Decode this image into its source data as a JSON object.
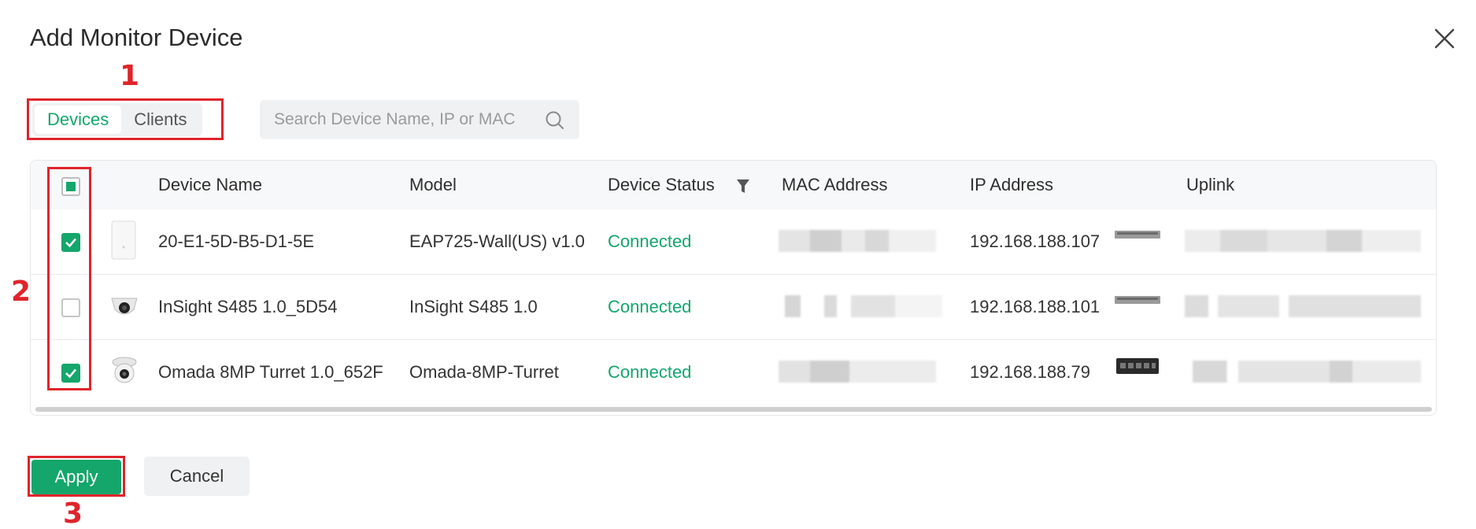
{
  "dialog": {
    "title": "Add Monitor Device",
    "close_icon": "close-icon"
  },
  "annotations": {
    "step1": "1",
    "step2": "2",
    "step3": "3",
    "color": "#e0242b"
  },
  "tabs": [
    {
      "label": "Devices",
      "active": true
    },
    {
      "label": "Clients",
      "active": false
    }
  ],
  "search": {
    "placeholder": "Search Device Name, IP or MAC",
    "value": "",
    "icon": "search-icon"
  },
  "table": {
    "columns": [
      "Device Name",
      "Model",
      "Device Status",
      "MAC Address",
      "IP Address",
      "Uplink"
    ],
    "status_filter_icon": "filter-icon",
    "select_all": "indeterminate",
    "rows": [
      {
        "checked": true,
        "thumbnail": "ap-wall-icon",
        "device_name": "20-E1-5D-B5-D1-5E",
        "model": "EAP725-Wall(US) v1.0",
        "status": "Connected",
        "mac_address": "redacted",
        "ip_address": "192.168.188.107",
        "uplink_icon": "switch-icon",
        "uplink": "redacted"
      },
      {
        "checked": false,
        "thumbnail": "dome-camera-icon",
        "device_name": "InSight S485 1.0_5D54",
        "model": "InSight S485 1.0",
        "status": "Connected",
        "mac_address": "redacted",
        "ip_address": "192.168.188.101",
        "uplink_icon": "switch-icon",
        "uplink": "redacted"
      },
      {
        "checked": true,
        "thumbnail": "turret-camera-icon",
        "device_name": "Omada 8MP Turret 1.0_652F",
        "model": "Omada-8MP-Turret",
        "status": "Connected",
        "mac_address": "redacted",
        "ip_address": "192.168.188.79",
        "uplink_icon": "switch-black-icon",
        "uplink": "redacted"
      }
    ]
  },
  "footer": {
    "apply_label": "Apply",
    "cancel_label": "Cancel"
  },
  "colors": {
    "accent": "#14a66b",
    "status_connected": "#14a66b",
    "annotation": "#e0242b"
  }
}
